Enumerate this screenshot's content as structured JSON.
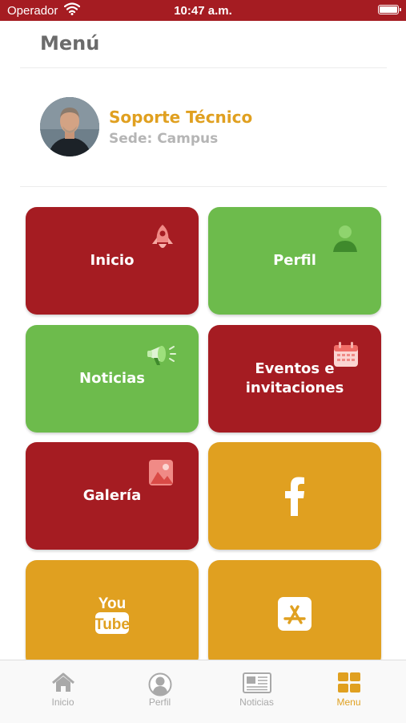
{
  "status_bar": {
    "carrier": "Operador",
    "time": "10:47 a.m."
  },
  "header": {
    "title": "Menú"
  },
  "profile": {
    "name": "Soporte Técnico",
    "sede": "Sede: Campus"
  },
  "tiles": [
    {
      "label": "Inicio",
      "color": "#a51c22",
      "icon": "rocket-icon"
    },
    {
      "label": "Perfil",
      "color": "#6dbb4c",
      "icon": "person-icon"
    },
    {
      "label": "Noticias",
      "color": "#6dbb4c",
      "icon": "megaphone-icon"
    },
    {
      "label": "Eventos e invitaciones",
      "color": "#a51c22",
      "icon": "calendar-icon"
    },
    {
      "label": "Galería",
      "color": "#a51c22",
      "icon": "image-icon"
    },
    {
      "label": "",
      "color": "#e0a020",
      "icon": "facebook-icon"
    },
    {
      "label": "",
      "color": "#e0a020",
      "icon": "youtube-icon",
      "logo_text": [
        "You",
        "Tube"
      ]
    },
    {
      "label": "",
      "color": "#e0a020",
      "icon": "app-store-icon"
    }
  ],
  "tabbar": {
    "items": [
      {
        "label": "Inicio",
        "icon": "home-icon",
        "active": false
      },
      {
        "label": "Perfil",
        "icon": "person-circle-icon",
        "active": false
      },
      {
        "label": "Noticias",
        "icon": "newspaper-icon",
        "active": false
      },
      {
        "label": "Menu",
        "icon": "grid-icon",
        "active": true
      }
    ]
  },
  "colors": {
    "brand_red": "#a51c22",
    "brand_green": "#6dbb4c",
    "brand_orange": "#e0a020"
  }
}
